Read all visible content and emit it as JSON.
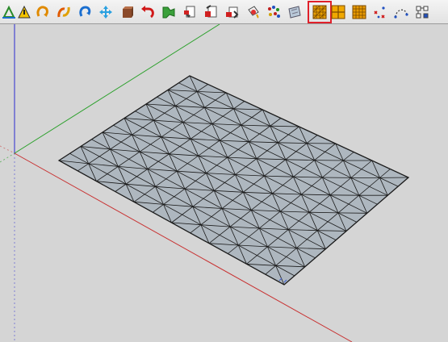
{
  "app": {
    "toolbar": {
      "tools": [
        {
          "id": "axes",
          "icon": "axes-icon"
        },
        {
          "id": "triangle",
          "icon": "triangle-warning-icon"
        },
        {
          "id": "curl-1",
          "icon": "curl-arrow-icon"
        },
        {
          "id": "curl-2",
          "icon": "double-curl-icon"
        },
        {
          "id": "curl-3",
          "icon": "curl-arrow-alt-icon"
        },
        {
          "id": "move",
          "icon": "move-cross-icon"
        },
        {
          "id": "box",
          "icon": "box-icon"
        },
        {
          "id": "undo",
          "icon": "red-undo-arrow-icon"
        },
        {
          "id": "green-tool",
          "icon": "green-shape-icon"
        },
        {
          "id": "doc-1",
          "icon": "document-tool-icon"
        },
        {
          "id": "doc-2",
          "icon": "document-red-tool-icon"
        },
        {
          "id": "doc-3",
          "icon": "document-arrow-tool-icon"
        },
        {
          "id": "paint",
          "icon": "paint-bucket-icon"
        },
        {
          "id": "cluster",
          "icon": "cluster-dots-icon"
        },
        {
          "id": "texture",
          "icon": "texture-map-icon"
        },
        {
          "id": "mesh-diagonal",
          "icon": "diagonal-grid-icon",
          "active": true
        },
        {
          "id": "grid-quad",
          "icon": "quad-grid-icon"
        },
        {
          "id": "grid-orange",
          "icon": "orange-grid-icon"
        },
        {
          "id": "scatter",
          "icon": "scatter-points-icon"
        },
        {
          "id": "arc",
          "icon": "arc-points-icon"
        },
        {
          "id": "nodes",
          "icon": "node-grid-icon"
        }
      ]
    },
    "scene": {
      "colors": {
        "background": "#d5d5d5",
        "plane_fill": "#aeb7bf",
        "mesh_line": "#1a1a1a",
        "axis_red": "#c83232",
        "axis_green": "#2aa02a",
        "axis_blue": "#2a2ad0"
      },
      "mesh": {
        "rows": 12,
        "cols": 12,
        "triangulated": true
      }
    }
  }
}
